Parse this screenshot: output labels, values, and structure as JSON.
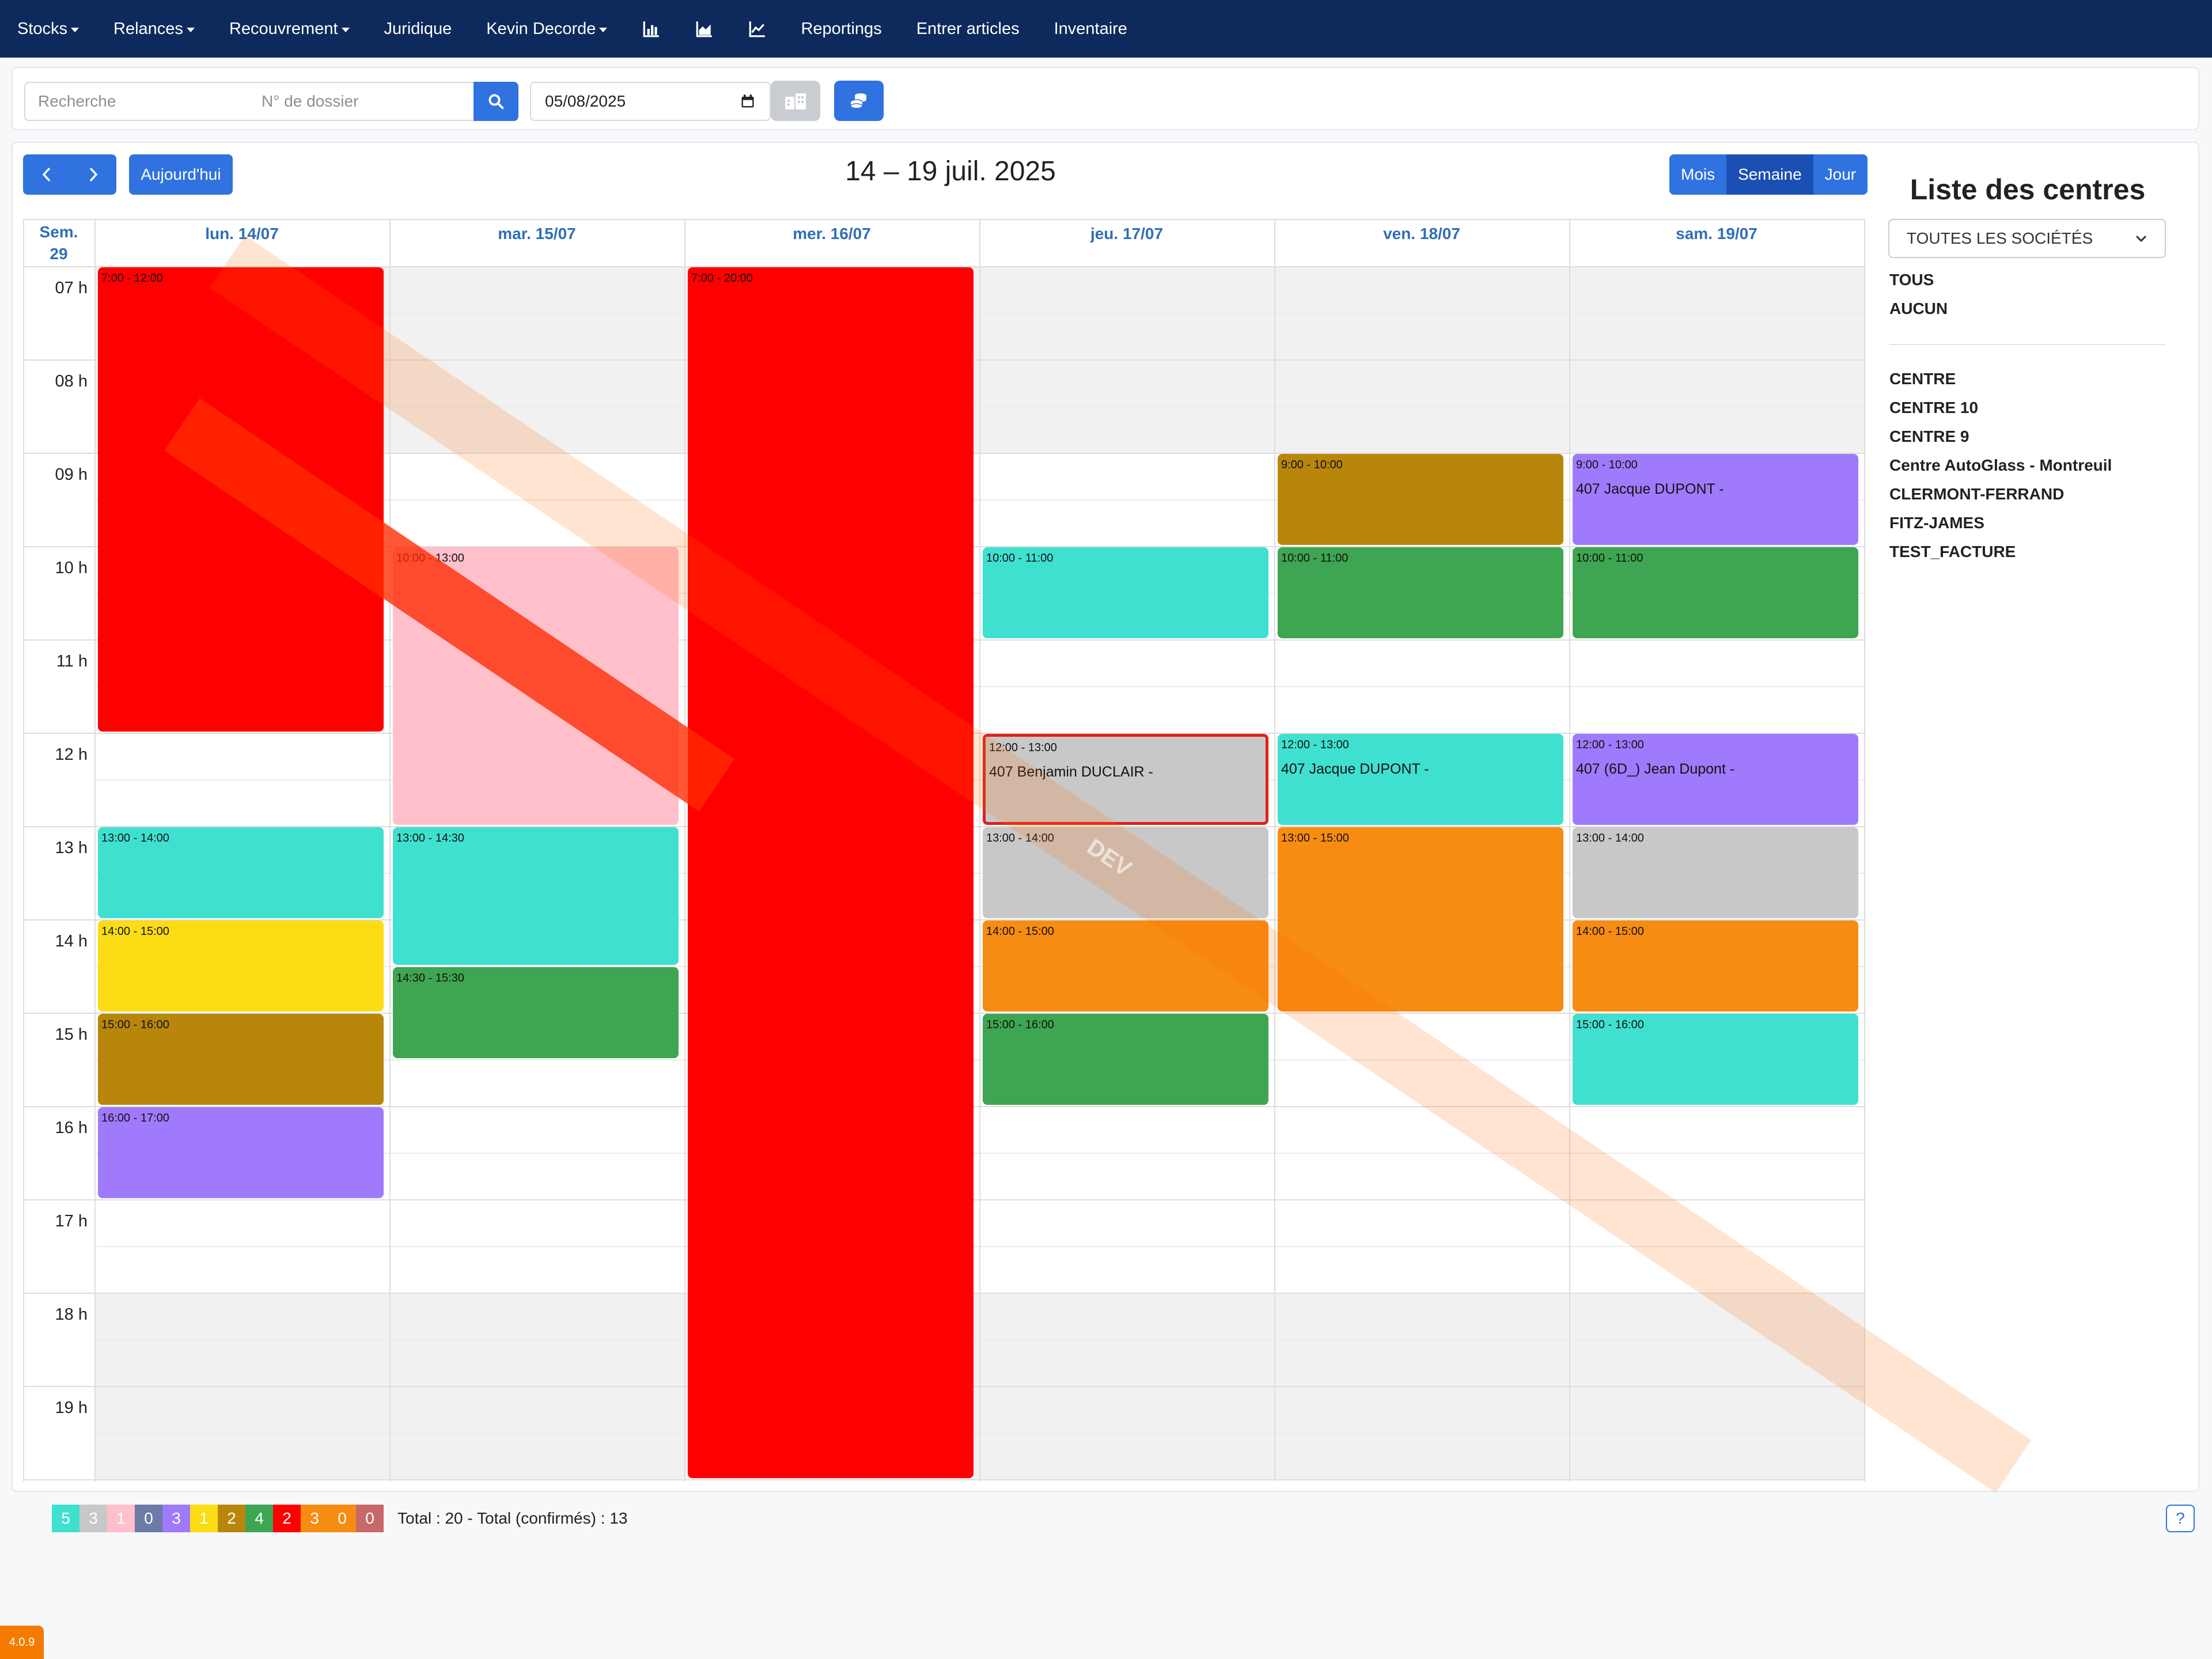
{
  "nav": {
    "items": [
      {
        "label": "Stocks",
        "dropdown": true,
        "name": "nav-stocks"
      },
      {
        "label": "Relances",
        "dropdown": true,
        "name": "nav-relances"
      },
      {
        "label": "Recouvrement",
        "dropdown": true,
        "name": "nav-recouvrement"
      },
      {
        "label": "Juridique",
        "dropdown": false,
        "name": "nav-juridique"
      },
      {
        "label": "Kevin Decorde",
        "dropdown": true,
        "name": "nav-user-menu"
      }
    ],
    "icon_items": [
      "bar-chart-icon",
      "area-chart-icon",
      "line-chart-icon"
    ],
    "right_items": [
      {
        "label": "Reportings",
        "name": "nav-reportings"
      },
      {
        "label": "Entrer articles",
        "name": "nav-entrer-articles"
      },
      {
        "label": "Inventaire",
        "name": "nav-inventaire"
      }
    ]
  },
  "toolbar": {
    "search_placeholder": "Recherche",
    "dossier_placeholder": "N° de dossier",
    "date_value": "05/08/2025"
  },
  "calendar": {
    "today_label": "Aujourd'hui",
    "title": "14 – 19 juil. 2025",
    "views": [
      "Mois",
      "Semaine",
      "Jour"
    ],
    "active_view": "Semaine",
    "week_label": "Sem.",
    "week_number": "29",
    "days": [
      "lun. 14/07",
      "mar. 15/07",
      "mer. 16/07",
      "jeu. 17/07",
      "ven. 18/07",
      "sam. 19/07"
    ],
    "hours": [
      "07 h",
      "08 h",
      "09 h",
      "10 h",
      "11 h",
      "12 h",
      "13 h",
      "14 h",
      "15 h",
      "16 h",
      "17 h",
      "18 h",
      "19 h"
    ],
    "events": [
      {
        "day": 0,
        "start": 7,
        "end": 12,
        "time": "7:00 - 12:00",
        "title": "",
        "color": "#ff0000"
      },
      {
        "day": 0,
        "start": 13,
        "end": 14,
        "time": "13:00 - 14:00",
        "title": "",
        "color": "#40e0d0"
      },
      {
        "day": 0,
        "start": 14,
        "end": 15,
        "time": "14:00 - 15:00",
        "title": "",
        "color": "#fcdc14"
      },
      {
        "day": 0,
        "start": 15,
        "end": 16,
        "time": "15:00 - 16:00",
        "title": "",
        "color": "#b8860b"
      },
      {
        "day": 0,
        "start": 16,
        "end": 17,
        "time": "16:00 - 17:00",
        "title": "",
        "color": "#a07afc"
      },
      {
        "day": 1,
        "start": 10,
        "end": 13,
        "time": "10:00 - 13:00",
        "title": "",
        "color": "#ffc0cb"
      },
      {
        "day": 1,
        "start": 13,
        "end": 14.5,
        "time": "13:00 - 14:30",
        "title": "",
        "color": "#40e0d0"
      },
      {
        "day": 1,
        "start": 14.5,
        "end": 15.5,
        "time": "14:30 - 15:30",
        "title": "",
        "color": "#3ea552"
      },
      {
        "day": 2,
        "start": 7,
        "end": 20,
        "time": "7:00 - 20:00",
        "title": "",
        "color": "#ff0000"
      },
      {
        "day": 3,
        "start": 10,
        "end": 11,
        "time": "10:00 - 11:00",
        "title": "",
        "color": "#40e0d0"
      },
      {
        "day": 3,
        "start": 12,
        "end": 13,
        "time": "12:00 - 13:00",
        "title": "407 Benjamin DUCLAIR -",
        "color": "#c8c8c8",
        "selected": true
      },
      {
        "day": 3,
        "start": 13,
        "end": 14,
        "time": "13:00 - 14:00",
        "title": "",
        "color": "#c8c8c8"
      },
      {
        "day": 3,
        "start": 14,
        "end": 15,
        "time": "14:00 - 15:00",
        "title": "",
        "color": "#f78c12"
      },
      {
        "day": 3,
        "start": 15,
        "end": 16,
        "time": "15:00 - 16:00",
        "title": "",
        "color": "#3ea552"
      },
      {
        "day": 4,
        "start": 9,
        "end": 10,
        "time": "9:00 - 10:00",
        "title": "",
        "color": "#b8860b"
      },
      {
        "day": 4,
        "start": 10,
        "end": 11,
        "time": "10:00 - 11:00",
        "title": "",
        "color": "#3ea552"
      },
      {
        "day": 4,
        "start": 12,
        "end": 13,
        "time": "12:00 - 13:00",
        "title": "407 Jacque DUPONT -",
        "color": "#40e0d0"
      },
      {
        "day": 4,
        "start": 13,
        "end": 15,
        "time": "13:00 - 15:00",
        "title": "",
        "color": "#f78c12"
      },
      {
        "day": 5,
        "start": 9,
        "end": 10,
        "time": "9:00 - 10:00",
        "title": "407 Jacque DUPONT -",
        "color": "#a07afc"
      },
      {
        "day": 5,
        "start": 10,
        "end": 11,
        "time": "10:00 - 11:00",
        "title": "",
        "color": "#3ea552"
      },
      {
        "day": 5,
        "start": 12,
        "end": 13,
        "time": "12:00 - 13:00",
        "title": "407 (6D_) Jean Dupont -",
        "color": "#a07afc"
      },
      {
        "day": 5,
        "start": 13,
        "end": 14,
        "time": "13:00 - 14:00",
        "title": "",
        "color": "#c8c8c8"
      },
      {
        "day": 5,
        "start": 14,
        "end": 15,
        "time": "14:00 - 15:00",
        "title": "",
        "color": "#f78c12"
      },
      {
        "day": 5,
        "start": 15,
        "end": 16,
        "time": "15:00 - 16:00",
        "title": "",
        "color": "#40e0d0"
      }
    ]
  },
  "sidebar": {
    "title": "Liste des centres",
    "select_value": "TOUTES LES SOCIÉTÉS",
    "quick": [
      "TOUS",
      "AUCUN"
    ],
    "centers": [
      "CENTRE",
      "CENTRE 10",
      "CENTRE 9",
      "Centre AutoGlass - Montreuil",
      "CLERMONT-FERRAND",
      "FITZ-JAMES",
      "TEST_FACTURE"
    ]
  },
  "watermark": "DEV",
  "legend": [
    {
      "value": "5",
      "color": "#40e0d0"
    },
    {
      "value": "3",
      "color": "#c8c8c8"
    },
    {
      "value": "1",
      "color": "#ffc0cb"
    },
    {
      "value": "0",
      "color": "#6b7aa6"
    },
    {
      "value": "3",
      "color": "#a07afc"
    },
    {
      "value": "1",
      "color": "#fcdc14"
    },
    {
      "value": "2",
      "color": "#b8860b"
    },
    {
      "value": "4",
      "color": "#3ea552"
    },
    {
      "value": "2",
      "color": "#ff0000"
    },
    {
      "value": "3",
      "color": "#f78c12"
    },
    {
      "value": "0",
      "color": "#f78c12"
    },
    {
      "value": "0",
      "color": "#c96868"
    }
  ],
  "totals": "Total : 20 - Total (confirmés) : 13",
  "help": "?",
  "version": "4.0.9"
}
